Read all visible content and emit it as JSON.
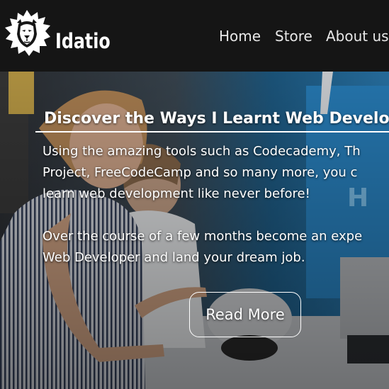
{
  "header": {
    "brand": "Idatio",
    "logo_icon": "lion-head-icon",
    "nav": [
      {
        "label": "Home"
      },
      {
        "label": "Store"
      },
      {
        "label": "About us"
      }
    ]
  },
  "hero": {
    "title": "Discover the Ways I Learnt Web Develop",
    "paragraph1_lines": [
      "Using the amazing tools such as Codecademy, Th",
      "Project, FreeCodeCamp and so many more, you c",
      "learn web development like never before!"
    ],
    "paragraph2_lines": [
      "Over the course of a few months become an expe",
      "Web Developer and land your dream job."
    ],
    "cta_label": "Read More"
  },
  "colors": {
    "header_bg": "#151515",
    "text": "#ffffff",
    "nav_text": "#e8e8e8"
  }
}
